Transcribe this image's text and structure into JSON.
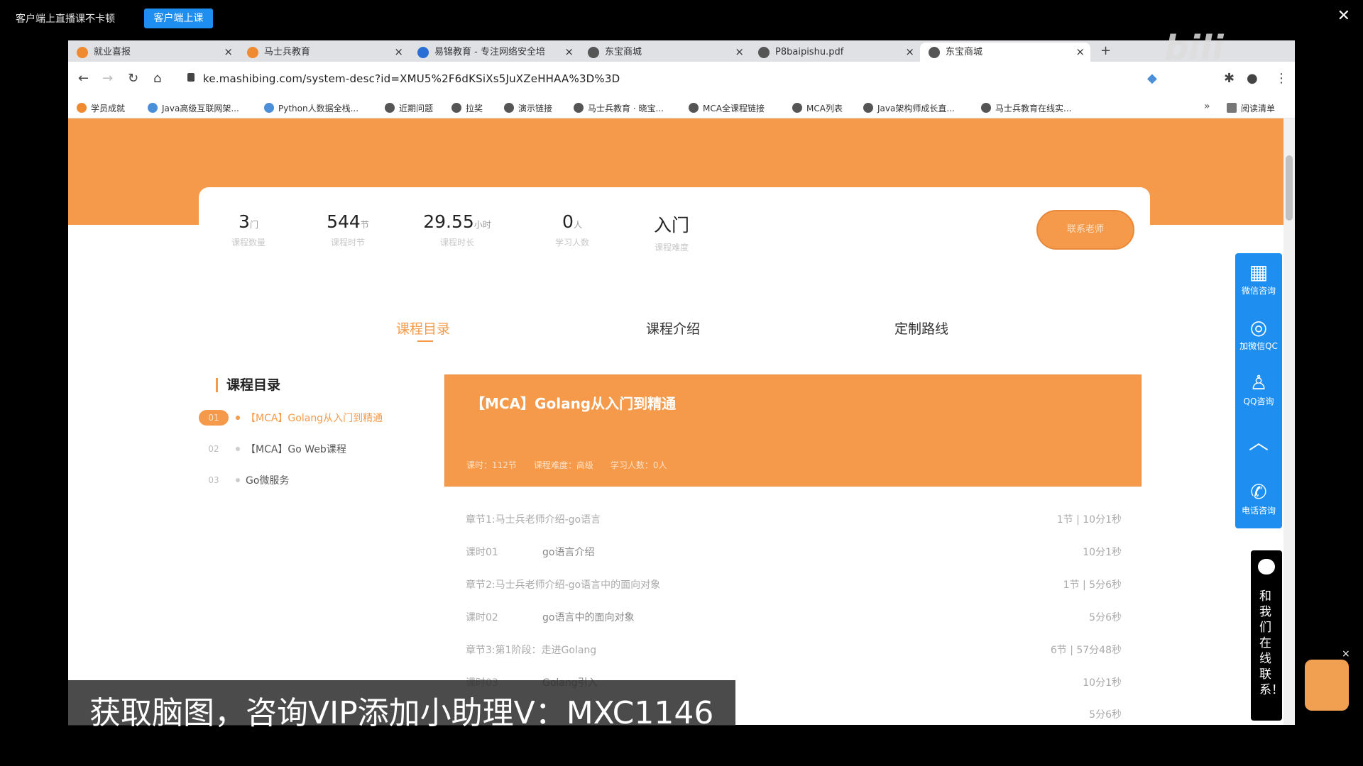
{
  "topbar": {
    "notice": "客户端上直播课不卡顿",
    "live_button": "客户端上课"
  },
  "browser": {
    "tabs": [
      {
        "label": "就业喜报",
        "favicon_color": "#f08a30"
      },
      {
        "label": "马士兵教育",
        "favicon_color": "#f08a30"
      },
      {
        "label": "易锦教育 - 专注网络安全培",
        "favicon_color": "#2a6fd6"
      },
      {
        "label": "东宝商城",
        "favicon_color": "#555555"
      },
      {
        "label": "P8baipishu.pdf",
        "favicon_color": "#555555"
      },
      {
        "label": "东宝商城",
        "favicon_color": "#555555"
      }
    ],
    "url": "ke.mashibing.com/system-desc?id=XMU5%2F6dKSiXs5JuXZeHHAA%3D%3D",
    "bookmarks": [
      "学员成就",
      "Java高级互联网架...",
      "Python人数据全栈...",
      "近期问题",
      "拉奖",
      "演示链接",
      "马士兵教育 · 晓宝...",
      "MCA全课程链接",
      "MCA列表",
      "Java架构师成长直...",
      "马士兵教育在线实..."
    ],
    "reading_list": "阅读清单"
  },
  "stats": [
    {
      "value": "3",
      "unit": "门",
      "label": "课程数量"
    },
    {
      "value": "544",
      "unit": "节",
      "label": "课程时节"
    },
    {
      "value": "29.55",
      "unit": "小时",
      "label": "课程时长"
    },
    {
      "value": "0",
      "unit": "人",
      "label": "学习人数"
    },
    {
      "value": "入门",
      "unit": "",
      "label": "课程难度"
    }
  ],
  "contact_button": "联系老师",
  "page_tabs": [
    "课程目录",
    "课程介绍",
    "定制路线"
  ],
  "toc": {
    "title": "课程目录",
    "items": [
      {
        "index": "01",
        "name": "【MCA】Golang从入门到精通"
      },
      {
        "index": "02",
        "name": "【MCA】Go Web课程"
      },
      {
        "index": "03",
        "name": "Go微服务"
      }
    ]
  },
  "course_card": {
    "title": "【MCA】Golang从入门到精通",
    "meta": "课时：112节　　课程难度：高级　　学习人数：0人"
  },
  "chapters": [
    {
      "left": "章节1:马士兵老师介绍-go语言",
      "mid": "",
      "right": "1节 | 10分1秒"
    },
    {
      "left": "课时01",
      "mid": "go语言介绍",
      "right": "10分1秒"
    },
    {
      "left": "章节2:马士兵老师介绍-go语言中的面向对象",
      "mid": "",
      "right": "1节 | 5分6秒"
    },
    {
      "left": "课时02",
      "mid": "go语言中的面向对象",
      "right": "5分6秒"
    },
    {
      "left": "章节3:第1阶段：走进Golang",
      "mid": "",
      "right": "6节 | 57分48秒"
    },
    {
      "left": "课时03",
      "mid": "Golang引入",
      "right": "10分1秒"
    },
    {
      "left": "",
      "mid": "",
      "right": "5分6秒"
    }
  ],
  "side_panel": [
    {
      "icon": "qr-code-icon",
      "label": "微信咨询"
    },
    {
      "icon": "headset-icon",
      "label": "加微信QC"
    },
    {
      "icon": "qq-icon",
      "label": "QQ咨询"
    },
    {
      "icon": "chevron-up-icon",
      "label": ""
    },
    {
      "icon": "phone-icon",
      "label": "电话咨询"
    }
  ],
  "chat_panel": "和我们在线联系！",
  "watermark": "获取脑图，咨询VIP添加小助理V：MXC1146",
  "colors": {
    "accent": "#f59a4a",
    "blue": "#1e8ff0"
  }
}
